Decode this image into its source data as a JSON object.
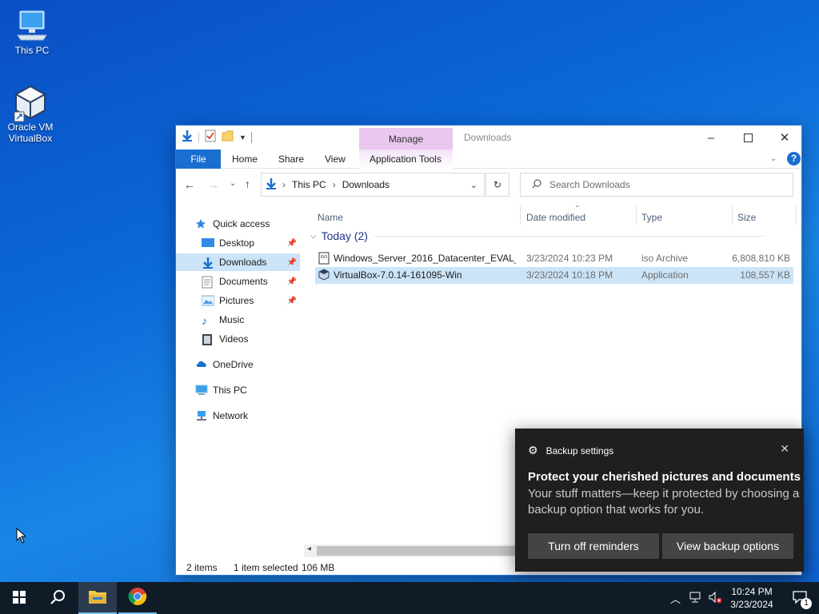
{
  "desktop": {
    "icons": [
      {
        "label": "This PC"
      },
      {
        "label": "Oracle VM\nVirtualBox"
      }
    ]
  },
  "explorer": {
    "title": "Downloads",
    "manage_tab": "Manage",
    "ribbon_tabs": {
      "file": "File",
      "home": "Home",
      "share": "Share",
      "view": "View",
      "app_tools": "Application Tools"
    },
    "breadcrumb": {
      "root": "This PC",
      "current": "Downloads"
    },
    "search_placeholder": "Search Downloads",
    "sidebar": {
      "quick_access": "Quick access",
      "items": [
        "Desktop",
        "Downloads",
        "Documents",
        "Pictures",
        "Music",
        "Videos"
      ],
      "onedrive": "OneDrive",
      "this_pc": "This PC",
      "network": "Network"
    },
    "columns": {
      "name": "Name",
      "date": "Date modified",
      "type": "Type",
      "size": "Size"
    },
    "group_label": "Today (2)",
    "files": [
      {
        "name": "Windows_Server_2016_Datacenter_EVAL_...",
        "date": "3/23/2024 10:23 PM",
        "type": "iso Archive",
        "size": "6,808,810 KB"
      },
      {
        "name": "VirtualBox-7.0.14-161095-Win",
        "date": "3/23/2024 10:18 PM",
        "type": "Application",
        "size": "108,557 KB"
      }
    ],
    "status": {
      "items": "2 items",
      "selected": "1 item selected",
      "size": "106 MB"
    }
  },
  "toast": {
    "app": "Backup settings",
    "title": "Protect your cherished pictures and documents",
    "body": "Your stuff matters—keep it protected by choosing a backup option that works for you.",
    "btn_off": "Turn off reminders",
    "btn_view": "View backup options"
  },
  "taskbar": {
    "time": "10:24 PM",
    "date": "3/23/2024",
    "notif_count": "1"
  },
  "colors": {
    "accent": "#1a6ed0",
    "selection": "#cce4f7",
    "manage": "#e9c7ef",
    "taskbar": "#101b28",
    "toast": "#1f1f1f"
  }
}
